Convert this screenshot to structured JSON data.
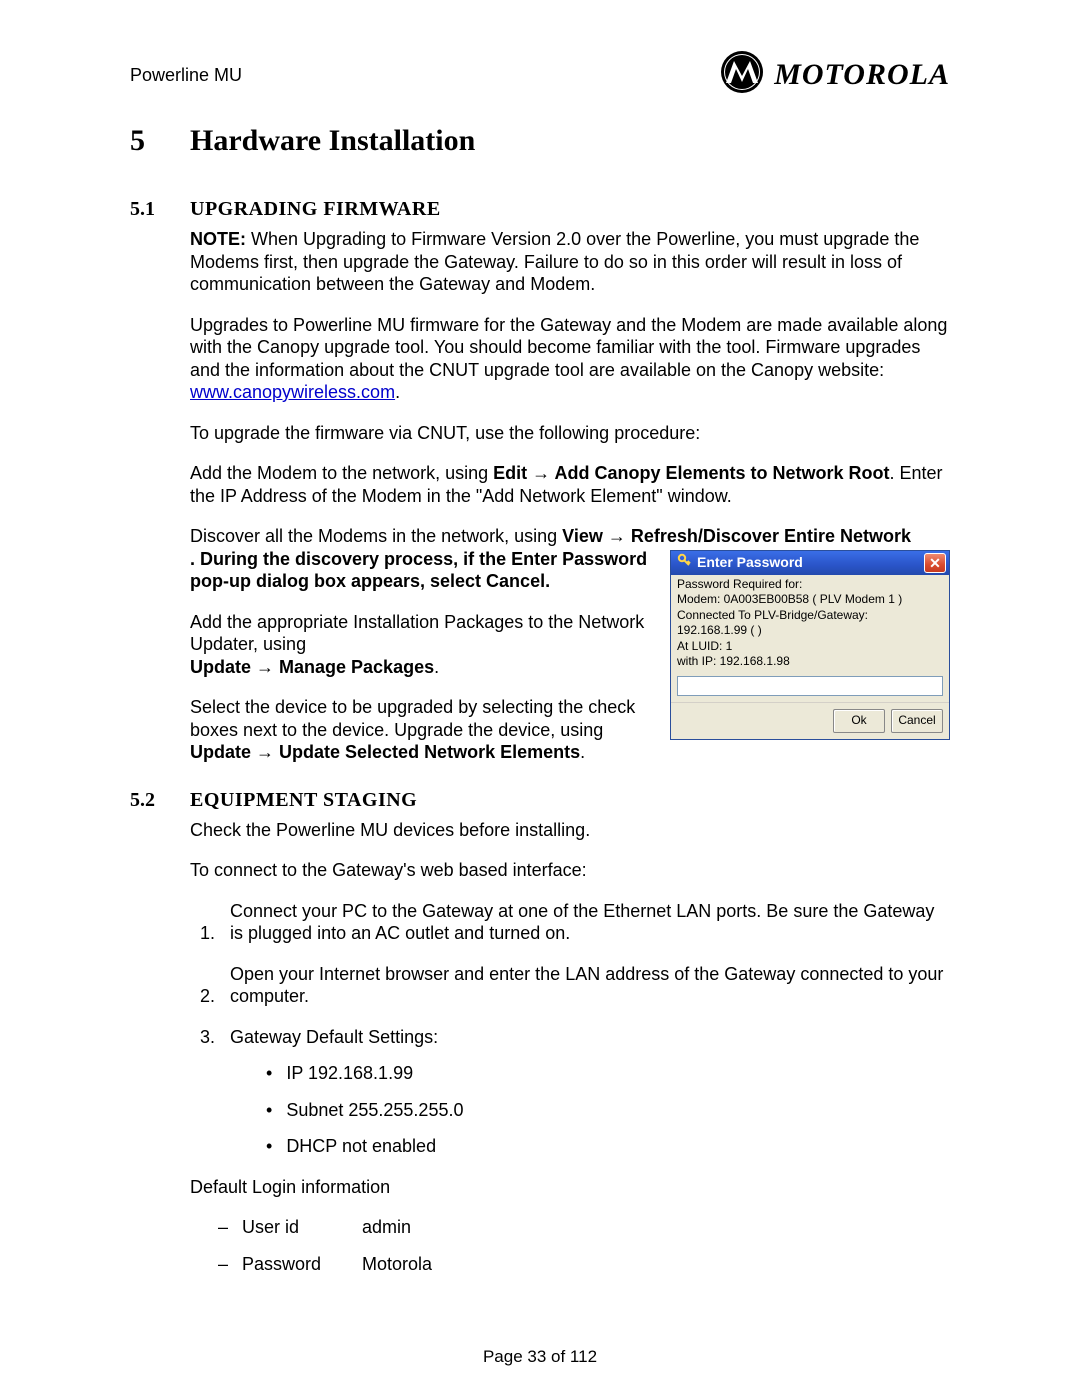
{
  "header": {
    "doc_title": "Powerline MU",
    "brand": "MOTOROLA"
  },
  "chapter": {
    "num": "5",
    "title": "Hardware Installation"
  },
  "s51": {
    "num": "5.1",
    "title": "UPGRADING FIRMWARE",
    "note_label": "NOTE:",
    "note_body": "  When Upgrading to Firmware Version 2.0 over the Powerline, you must upgrade the Modems first, then upgrade the Gateway.  Failure to do so in this order will result in loss of communication between the Gateway and Modem.",
    "p2a": "Upgrades to Powerline MU firmware for the Gateway and the Modem are made available along with the Canopy upgrade tool. You should become familiar with the tool. Firmware upgrades and the information about the CNUT upgrade tool are available on the Canopy website: ",
    "p2_link": "www.canopywireless.com",
    "p2b": ".",
    "p3": "To upgrade the firmware via CNUT, use the following procedure:",
    "p4a": "Add the Modem to the network, using ",
    "p4_edit": "Edit ",
    "arrow": "→",
    "p4_add": " Add Canopy Elements to Network Root",
    "p4c": ". Enter the IP Address of the Modem in the \"Add Network Element\" window.",
    "p5a": "Discover all the Modems in the network, using ",
    "p5_view": "View ",
    "p5_refresh": " Refresh/Discover Entire Network",
    "p5b": ".  ",
    "p5_bold2": "During the discovery process, if the Enter Password pop-up dialog box appears, select Cancel.",
    "p6": "Add the appropriate Installation Packages to the Network Updater, using",
    "p6_bold": "Update ",
    "p6_bold2": " Manage Packages",
    "p6_dot": ".",
    "p7": "Select the device to be upgraded by selecting the check boxes next to the device.    Upgrade the device, using ",
    "p7_bold": "Update ",
    "p7_bold2": " Update Selected Network Elements",
    "p7_dot": "."
  },
  "dialog": {
    "title": "Enter Password",
    "lines": [
      "Password Required for:",
      "Modem: 0A003EB00B58 ( PLV Modem 1 )",
      "Connected To PLV-Bridge/Gateway:",
      "192.168.1.99 ( )",
      "At LUID: 1",
      "with IP: 192.168.1.98"
    ],
    "ok": "Ok",
    "cancel": "Cancel"
  },
  "s52": {
    "num": "5.2",
    "title": "EQUIPMENT STAGING",
    "p1": "Check the Powerline MU devices before installing.",
    "p2": "To connect to the Gateway's web based interface:",
    "li1": "Connect your PC to the Gateway at one of the Ethernet LAN ports. Be sure the Gateway is plugged into an AC outlet and turned on.",
    "li2": "Open your Internet browser and enter the LAN address of the Gateway connected to your computer.",
    "li3": "Gateway Default Settings:",
    "b1": "IP 192.168.1.99",
    "b2": "Subnet 255.255.255.0",
    "b3": "DHCP not enabled",
    "login_header": "Default Login information",
    "login_user_label": "User id",
    "login_user_value": "admin",
    "login_pass_label": "Password",
    "login_pass_value": "Motorola"
  },
  "footer": "Page 33 of 112"
}
